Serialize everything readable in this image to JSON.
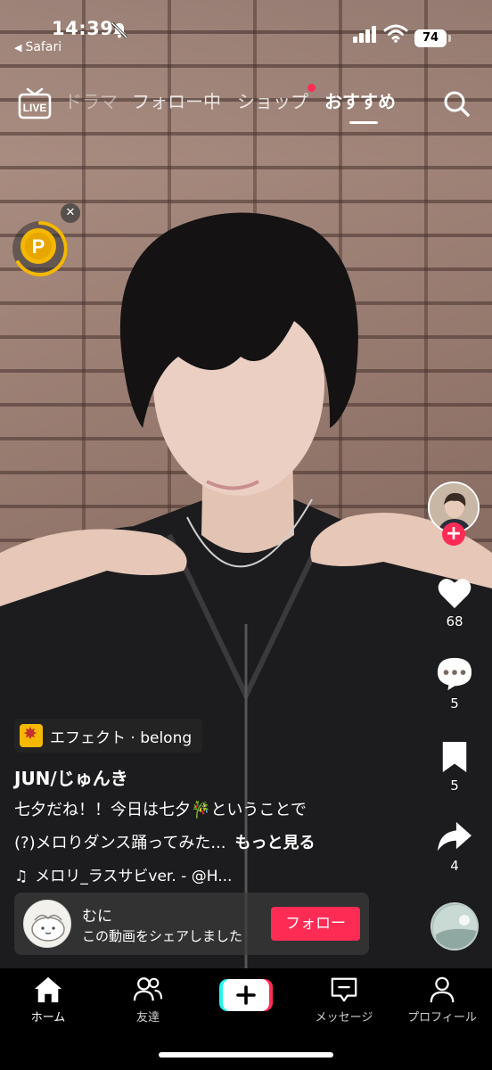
{
  "status_bar": {
    "time": "14:39",
    "back_app": "Safari",
    "battery": "74"
  },
  "top_nav": {
    "live_label": "LIVE",
    "tabs": [
      {
        "label": "ドラマ"
      },
      {
        "label": "フォロー中"
      },
      {
        "label": "ショップ",
        "has_dot": true
      },
      {
        "label": "おすすめ",
        "active": true
      }
    ]
  },
  "coin": {
    "label": "P"
  },
  "rail": {
    "likes": "68",
    "comments": "5",
    "bookmarks": "5",
    "shares": "4"
  },
  "post": {
    "effect": "エフェクト · belong",
    "username": "JUN/じゅんき",
    "caption_line1": "七夕だね！！今日は七夕🎋ということで",
    "caption_line2": "(?)メロりダンス踊ってみた...",
    "more": "もっと見る",
    "music": "メロリ_ラスサビver. - @H..."
  },
  "share_banner": {
    "name": "むに",
    "text": "この動画をシェアしました",
    "follow_label": "フォロー"
  },
  "bottom_nav": {
    "items": [
      {
        "label": "ホーム",
        "active": true
      },
      {
        "label": "友達"
      },
      {
        "label": "メッセージ"
      },
      {
        "label": "プロフィール"
      }
    ]
  },
  "colors": {
    "accent": "#fe2c55",
    "coin": "#f5b800",
    "tiktok_cyan": "#25f4ee"
  }
}
